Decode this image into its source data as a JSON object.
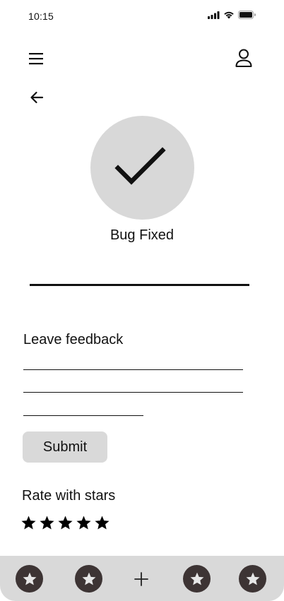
{
  "status_bar": {
    "time": "10:15"
  },
  "result": {
    "title": "Bug Fixed"
  },
  "feedback": {
    "label": "Leave feedback",
    "submit_label": "Submit"
  },
  "rating": {
    "label": "Rate with stars",
    "max_stars": 5
  },
  "bottom_nav": {
    "items": [
      {
        "icon": "star-icon"
      },
      {
        "icon": "star-icon"
      },
      {
        "icon": "plus-icon"
      },
      {
        "icon": "star-icon"
      },
      {
        "icon": "star-icon"
      }
    ]
  },
  "colors": {
    "circle_bg": "#d8d8d8",
    "button_bg": "#d9d9d9",
    "tab_bg": "#3d3434",
    "nav_bg": "#d9d9d9",
    "text": "#111111"
  }
}
